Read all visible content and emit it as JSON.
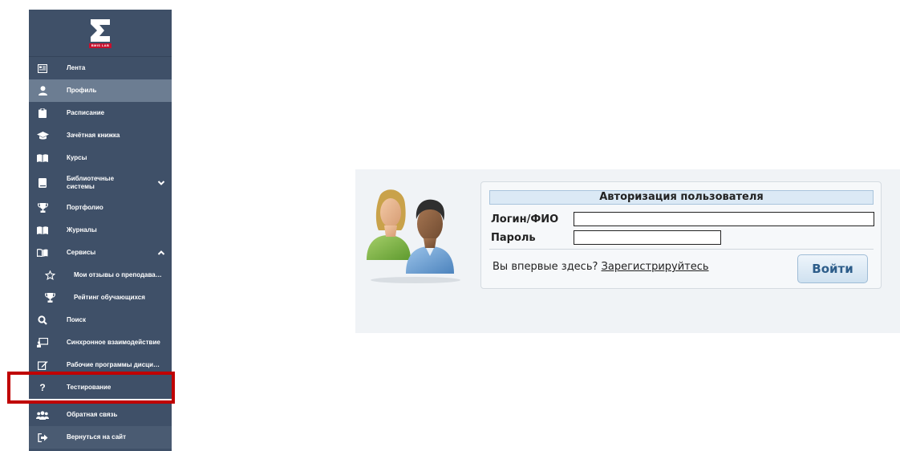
{
  "sidebar": {
    "logo_sub": "BMIS LAB",
    "items": [
      {
        "label": "Лента",
        "icon": "newspaper-icon"
      },
      {
        "label": "Профиль",
        "icon": "user-icon"
      },
      {
        "label": "Расписание",
        "icon": "clipboard-icon"
      },
      {
        "label": "Зачётная книжка",
        "icon": "graduation-cap-icon"
      },
      {
        "label": "Курсы",
        "icon": "book-open-icon"
      },
      {
        "label": "Библиотечные системы",
        "icon": "book-icon"
      },
      {
        "label": "Портфолио",
        "icon": "trophy-icon"
      },
      {
        "label": "Журналы",
        "icon": "book-open-icon"
      },
      {
        "label": "Сервисы",
        "icon": "reader-icon"
      },
      {
        "label": "Мои отзывы о преподавателях",
        "icon": "star-icon"
      },
      {
        "label": "Рейтинг обучающихся",
        "icon": "trophy-icon"
      },
      {
        "label": "Поиск",
        "icon": "search-icon"
      },
      {
        "label": "Синхронное взаимодействие",
        "icon": "presentation-icon"
      },
      {
        "label": "Рабочие программы дисциплин",
        "icon": "edit-icon"
      },
      {
        "label": "Тестирование",
        "icon": "question-icon"
      },
      {
        "label": "Обратная связь",
        "icon": "users-icon"
      },
      {
        "label": "Вернуться на сайт",
        "icon": "sign-out-icon"
      }
    ],
    "active_item": "Профиль",
    "highlighted_item": "Тестирование"
  },
  "login": {
    "title": "Авторизация пользователя",
    "login_label": "Логин/ФИО",
    "login_value": "",
    "password_label": "Пароль",
    "password_value": "",
    "first_time_text": "Вы впервые здесь?",
    "register_link": "Зарегистрируйтесь",
    "submit_label": "Войти"
  },
  "colors": {
    "sidebar_bg": "#3f5068",
    "active_item_bg": "#6c7d92",
    "highlight_frame": "#c00000",
    "logo_accent": "#c8102e"
  }
}
